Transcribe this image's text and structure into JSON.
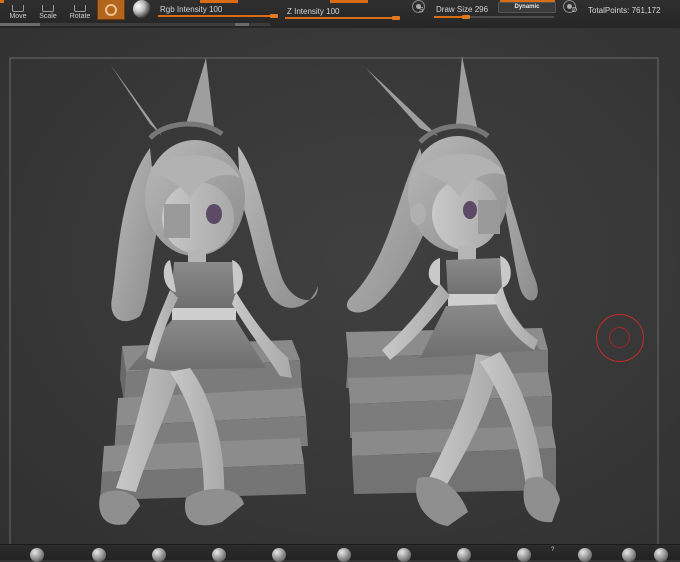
{
  "toolbar": {
    "move_label": "Move",
    "scale_label": "Scale",
    "rotate_label": "Rotate",
    "draw_mode_icon": "draw-ring-icon",
    "material_icon": "material-sphere-icon",
    "rgb_intensity": {
      "label": "Rgb Intensity",
      "value": "100",
      "fraction": 1.0
    },
    "z_intensity": {
      "label": "Z Intensity",
      "value": "100",
      "fraction": 1.0
    },
    "s_key": "S",
    "d_key": "D",
    "draw_size": {
      "label": "Draw Size",
      "value": "296",
      "fraction": 0.3
    },
    "dynamic_label": "Dynamic",
    "total_points": "TotalPoints: 761,172"
  },
  "canvas": {
    "background": "#383838",
    "frame_color": "#6a6a6a",
    "brush_cursor_color": "#c42b2b",
    "model_color": "#a6a6a6"
  },
  "brush_shelf": {
    "icons": [
      "brush-1-icon",
      "brush-2-icon",
      "brush-3-icon",
      "brush-4-icon",
      "brush-5-icon",
      "brush-6-icon",
      "brush-7-icon",
      "brush-8-icon",
      "brush-9-icon",
      "brush-10-icon",
      "brush-11-icon",
      "brush-12-icon",
      "brush-13-icon",
      "brush-14-icon"
    ],
    "count_label": "?"
  },
  "colors": {
    "accent": "#d96d16",
    "ui_dark": "#262626"
  }
}
